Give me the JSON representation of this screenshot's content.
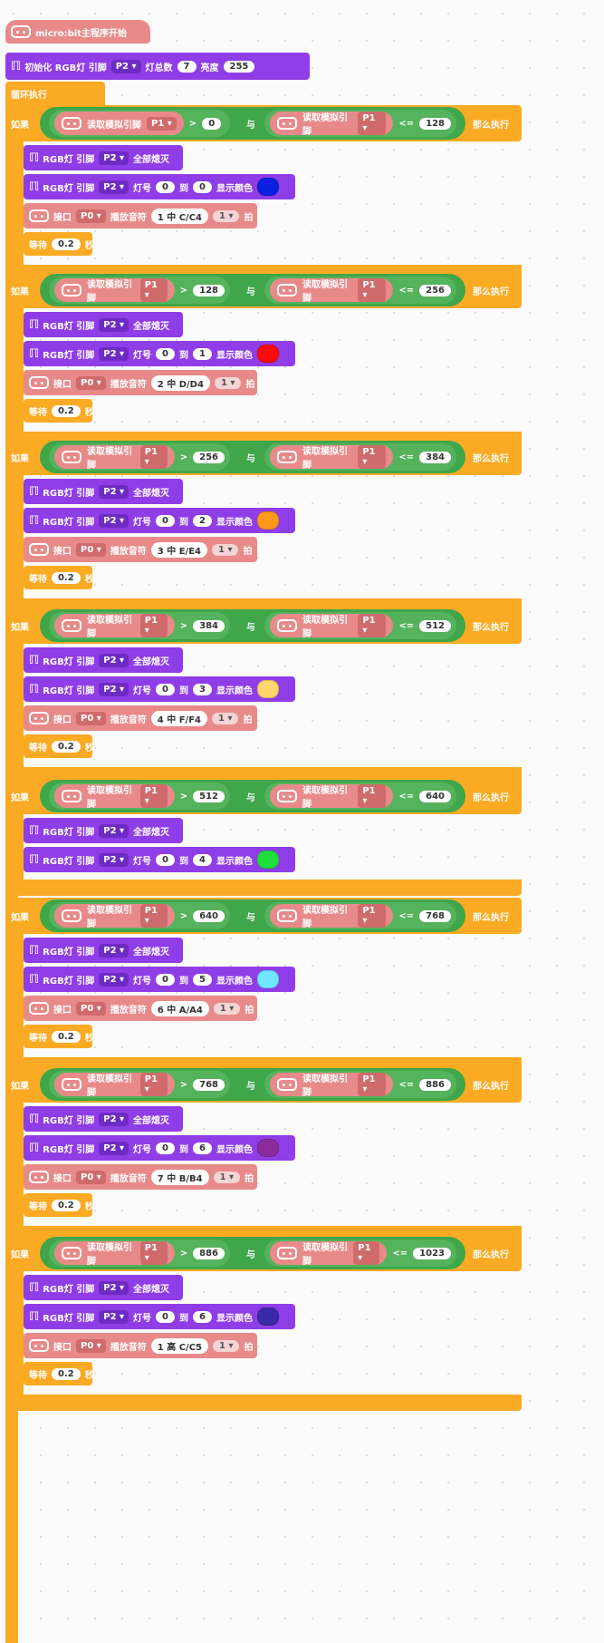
{
  "start": {
    "label": "micro:bit主程序开始"
  },
  "init": {
    "label": "初始化 RGB灯 引脚",
    "pin": "P2",
    "count_label": "灯总数",
    "count": "7",
    "bright_label": "亮度",
    "bright": "255"
  },
  "loop": {
    "label": "循环执行"
  },
  "common": {
    "if": "如果",
    "then": "那么执行",
    "read": "读取模拟引脚",
    "read_pin": "P1",
    "gt": ">",
    "le": "<=",
    "and": "与",
    "rgb_pin": "RGB灯 引脚",
    "rgb_pin2": "P2",
    "all_off": "全部熄灭",
    "lamp": "灯号",
    "to": "到",
    "show": "显示颜色",
    "port": "接口",
    "port_pin": "P0",
    "play": "播放音符",
    "beat": "拍",
    "beat_val": "1",
    "wait": "等待",
    "wait_val": "0.2",
    "sec": "秒",
    "from": "0"
  },
  "branches": [
    {
      "lo": "0",
      "hi": "128",
      "to": "0",
      "color": "#0b1fe0",
      "note": "1 中 C/C4"
    },
    {
      "lo": "128",
      "hi": "256",
      "to": "1",
      "color": "#ff0a0a",
      "note": "2 中 D/D4"
    },
    {
      "lo": "256",
      "hi": "384",
      "to": "2",
      "color": "#ff9a18",
      "note": "3 中 E/E4"
    },
    {
      "lo": "384",
      "hi": "512",
      "to": "3",
      "color": "#ffd66b",
      "note": "4 中 F/F4"
    },
    {
      "lo": "512",
      "hi": "640",
      "to": "4",
      "color": "#1fe03a",
      "note": null
    },
    {
      "lo": "640",
      "hi": "768",
      "to": "5",
      "color": "#6fe8ff",
      "note": "6 中 A/A4"
    },
    {
      "lo": "768",
      "hi": "886",
      "to": "6",
      "color": "#8a2c9c",
      "note": "7 中 B/B4"
    },
    {
      "lo": "886",
      "hi": "1023",
      "to": "6",
      "color": "#3a2aa8",
      "note": "1 高 C/C5"
    }
  ]
}
